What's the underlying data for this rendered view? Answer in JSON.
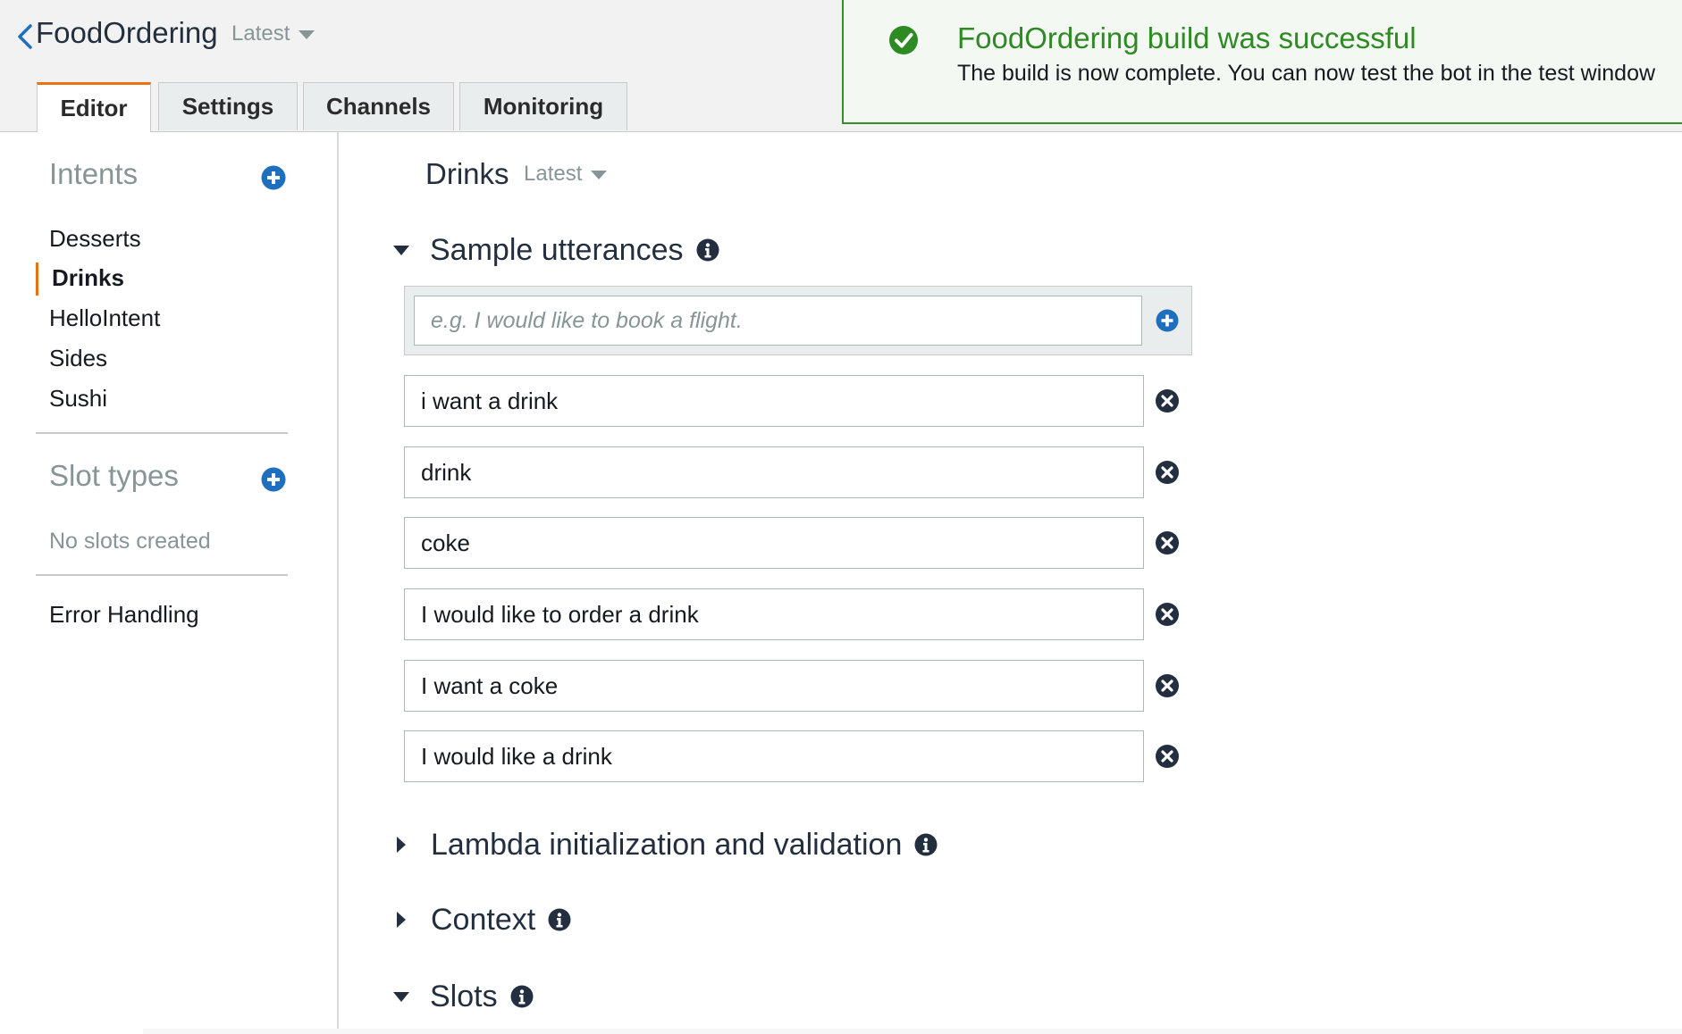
{
  "header": {
    "bot_name": "FoodOrdering",
    "version_label": "Latest",
    "tabs": [
      {
        "label": "Editor",
        "active": true
      },
      {
        "label": "Settings",
        "active": false
      },
      {
        "label": "Channels",
        "active": false
      },
      {
        "label": "Monitoring",
        "active": false
      }
    ]
  },
  "notification": {
    "title": "FoodOrdering build was successful",
    "message": "The build is now complete. You can now test the bot in the test window",
    "icon": "check-circle-icon",
    "color": "#2e8a23"
  },
  "sidebar": {
    "intents_heading": "Intents",
    "intents": [
      {
        "label": "Desserts",
        "selected": false
      },
      {
        "label": "Drinks",
        "selected": true
      },
      {
        "label": "HelloIntent",
        "selected": false
      },
      {
        "label": "Sides",
        "selected": false
      },
      {
        "label": "Sushi",
        "selected": false
      }
    ],
    "slot_types_heading": "Slot types",
    "no_slots_text": "No slots created",
    "error_handling_label": "Error Handling"
  },
  "main": {
    "intent_name": "Drinks",
    "intent_version": "Latest",
    "sections": {
      "sample_utterances": {
        "label": "Sample utterances",
        "expanded": true
      },
      "lambda": {
        "label": "Lambda initialization and validation",
        "expanded": false
      },
      "context": {
        "label": "Context",
        "expanded": false
      },
      "slots": {
        "label": "Slots",
        "expanded": true
      }
    },
    "utterance_placeholder": "e.g. I would like to book a flight.",
    "utterances": [
      "i want a drink",
      "drink",
      "coke",
      "I would like to order a drink",
      "I want a coke",
      "I would like a drink"
    ]
  },
  "colors": {
    "accent": "#ec7211",
    "link_blue": "#1f6fbf",
    "success_green": "#2e8a23"
  }
}
